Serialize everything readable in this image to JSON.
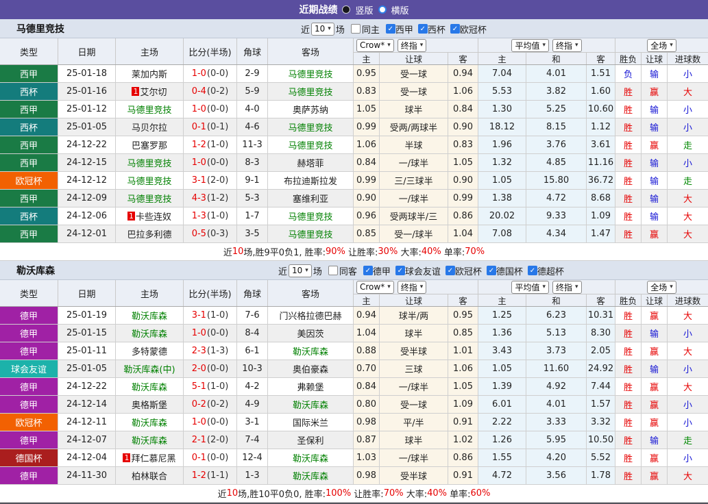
{
  "topbar": {
    "title": "近期战绩",
    "options": [
      {
        "label": "竖版",
        "selected": true
      },
      {
        "label": "横版",
        "selected": false
      }
    ]
  },
  "header": {
    "left_cols": [
      "类型",
      "日期",
      "主场",
      "比分(半场)",
      "角球",
      "客场"
    ],
    "group_selects": {
      "crow": "Crow*",
      "crow_final": "终指",
      "avg": "平均值",
      "avg_final": "终指",
      "scope": "全场"
    },
    "sub_cols_crow": [
      "主",
      "让球",
      "客"
    ],
    "sub_cols_avg": [
      "主",
      "和",
      "客"
    ],
    "sub_cols_result": [
      "胜负",
      "让球",
      "进球数"
    ]
  },
  "colors": {
    "league": {
      "西甲": "#1a7b45",
      "西杯": "#147c7c",
      "欧冠杯": "#f26102",
      "德甲": "#a021a5",
      "球会友谊": "#1cb2aa",
      "德国杯": "#aa1e1e"
    },
    "result": {
      "r": "#e60000",
      "b": "#1414d4",
      "g": "#008800"
    },
    "score_fulltime": "#e60000",
    "team_highlight": "#008000",
    "accent_bar": "#5a4e9f"
  },
  "sections": [
    {
      "team": "马德里竞技",
      "filter": {
        "prefix": "近",
        "count": "10",
        "suffix": "场",
        "same": {
          "label": "同主",
          "checked": false
        },
        "leagues": [
          {
            "label": "西甲",
            "checked": true
          },
          {
            "label": "西杯",
            "checked": true
          },
          {
            "label": "欧冠杯",
            "checked": true
          }
        ]
      },
      "rows": [
        {
          "league": "西甲",
          "date": "25-01-18",
          "home": "莱加内斯",
          "home_hl": false,
          "badge": null,
          "ft": "1-0",
          "ht": "(0-0)",
          "corner": "2-9",
          "away": "马德里竞技",
          "away_hl": true,
          "crow": [
            "0.95",
            "受一球",
            "0.94"
          ],
          "avg": [
            "7.04",
            "4.01",
            "1.51"
          ],
          "res": [
            [
              "负",
              "b"
            ],
            [
              "输",
              "b"
            ],
            [
              "小",
              "b"
            ]
          ]
        },
        {
          "league": "西杯",
          "date": "25-01-16",
          "home": "艾尔切",
          "home_hl": false,
          "badge": "1",
          "ft": "0-4",
          "ht": "(0-2)",
          "corner": "5-9",
          "away": "马德里竞技",
          "away_hl": true,
          "crow": [
            "0.83",
            "受一球",
            "1.06"
          ],
          "avg": [
            "5.53",
            "3.82",
            "1.60"
          ],
          "res": [
            [
              "胜",
              "r"
            ],
            [
              "赢",
              "r"
            ],
            [
              "大",
              "r"
            ]
          ]
        },
        {
          "league": "西甲",
          "date": "25-01-12",
          "home": "马德里竞技",
          "home_hl": true,
          "badge": null,
          "ft": "1-0",
          "ht": "(0-0)",
          "corner": "4-0",
          "away": "奥萨苏纳",
          "away_hl": false,
          "crow": [
            "1.05",
            "球半",
            "0.84"
          ],
          "avg": [
            "1.30",
            "5.25",
            "10.60"
          ],
          "res": [
            [
              "胜",
              "r"
            ],
            [
              "输",
              "b"
            ],
            [
              "小",
              "b"
            ]
          ]
        },
        {
          "league": "西杯",
          "date": "25-01-05",
          "home": "马贝尔拉",
          "home_hl": false,
          "badge": null,
          "ft": "0-1",
          "ht": "(0-1)",
          "corner": "4-6",
          "away": "马德里竞技",
          "away_hl": true,
          "crow": [
            "0.99",
            "受两/两球半",
            "0.90"
          ],
          "avg": [
            "18.12",
            "8.15",
            "1.12"
          ],
          "res": [
            [
              "胜",
              "r"
            ],
            [
              "输",
              "b"
            ],
            [
              "小",
              "b"
            ]
          ]
        },
        {
          "league": "西甲",
          "date": "24-12-22",
          "home": "巴塞罗那",
          "home_hl": false,
          "badge": null,
          "ft": "1-2",
          "ht": "(1-0)",
          "corner": "11-3",
          "away": "马德里竞技",
          "away_hl": true,
          "crow": [
            "1.06",
            "半球",
            "0.83"
          ],
          "avg": [
            "1.96",
            "3.76",
            "3.61"
          ],
          "res": [
            [
              "胜",
              "r"
            ],
            [
              "赢",
              "r"
            ],
            [
              "走",
              "g"
            ]
          ]
        },
        {
          "league": "西甲",
          "date": "24-12-15",
          "home": "马德里竞技",
          "home_hl": true,
          "badge": null,
          "ft": "1-0",
          "ht": "(0-0)",
          "corner": "8-3",
          "away": "赫塔菲",
          "away_hl": false,
          "crow": [
            "0.84",
            "一/球半",
            "1.05"
          ],
          "avg": [
            "1.32",
            "4.85",
            "11.16"
          ],
          "res": [
            [
              "胜",
              "r"
            ],
            [
              "输",
              "b"
            ],
            [
              "小",
              "b"
            ]
          ]
        },
        {
          "league": "欧冠杯",
          "date": "24-12-12",
          "home": "马德里竞技",
          "home_hl": true,
          "badge": null,
          "ft": "3-1",
          "ht": "(2-0)",
          "corner": "9-1",
          "away": "布拉迪斯拉发",
          "away_hl": false,
          "crow": [
            "0.99",
            "三/三球半",
            "0.90"
          ],
          "avg": [
            "1.05",
            "15.80",
            "36.72"
          ],
          "res": [
            [
              "胜",
              "r"
            ],
            [
              "输",
              "b"
            ],
            [
              "走",
              "g"
            ]
          ]
        },
        {
          "league": "西甲",
          "date": "24-12-09",
          "home": "马德里竞技",
          "home_hl": true,
          "badge": null,
          "ft": "4-3",
          "ht": "(1-2)",
          "corner": "5-3",
          "away": "塞维利亚",
          "away_hl": false,
          "crow": [
            "0.90",
            "一/球半",
            "0.99"
          ],
          "avg": [
            "1.38",
            "4.72",
            "8.68"
          ],
          "res": [
            [
              "胜",
              "r"
            ],
            [
              "输",
              "b"
            ],
            [
              "大",
              "r"
            ]
          ]
        },
        {
          "league": "西杯",
          "date": "24-12-06",
          "home": "卡些连奴",
          "home_hl": false,
          "badge": "1",
          "ft": "1-3",
          "ht": "(1-0)",
          "corner": "1-7",
          "away": "马德里竞技",
          "away_hl": true,
          "crow": [
            "0.96",
            "受两球半/三",
            "0.86"
          ],
          "avg": [
            "20.02",
            "9.33",
            "1.09"
          ],
          "res": [
            [
              "胜",
              "r"
            ],
            [
              "输",
              "b"
            ],
            [
              "大",
              "r"
            ]
          ]
        },
        {
          "league": "西甲",
          "date": "24-12-01",
          "home": "巴拉多利德",
          "home_hl": false,
          "badge": null,
          "ft": "0-5",
          "ht": "(0-3)",
          "corner": "3-5",
          "away": "马德里竞技",
          "away_hl": true,
          "crow": [
            "0.85",
            "受一/球半",
            "1.04"
          ],
          "avg": [
            "7.08",
            "4.34",
            "1.47"
          ],
          "res": [
            [
              "胜",
              "r"
            ],
            [
              "赢",
              "r"
            ],
            [
              "大",
              "r"
            ]
          ]
        }
      ],
      "summary": [
        [
          "近",
          0
        ],
        [
          "10",
          1
        ],
        [
          "场,胜9平0负1, 胜率:",
          0
        ],
        [
          "90%",
          1
        ],
        [
          " 让胜率:",
          0
        ],
        [
          "30%",
          1
        ],
        [
          " 大率:",
          0
        ],
        [
          "40%",
          1
        ],
        [
          " 单率:",
          0
        ],
        [
          "70%",
          1
        ]
      ]
    },
    {
      "team": "勒沃库森",
      "filter": {
        "prefix": "近",
        "count": "10",
        "suffix": "场",
        "same": {
          "label": "同客",
          "checked": false
        },
        "leagues": [
          {
            "label": "德甲",
            "checked": true
          },
          {
            "label": "球会友谊",
            "checked": true
          },
          {
            "label": "欧冠杯",
            "checked": true
          },
          {
            "label": "德国杯",
            "checked": true
          },
          {
            "label": "德超杯",
            "checked": true
          }
        ]
      },
      "rows": [
        {
          "league": "德甲",
          "date": "25-01-19",
          "home": "勒沃库森",
          "home_hl": true,
          "badge": null,
          "ft": "3-1",
          "ht": "(1-0)",
          "corner": "7-6",
          "away": "门兴格拉德巴赫",
          "away_hl": false,
          "crow": [
            "0.94",
            "球半/两",
            "0.95"
          ],
          "avg": [
            "1.25",
            "6.23",
            "10.31"
          ],
          "res": [
            [
              "胜",
              "r"
            ],
            [
              "赢",
              "r"
            ],
            [
              "大",
              "r"
            ]
          ]
        },
        {
          "league": "德甲",
          "date": "25-01-15",
          "home": "勒沃库森",
          "home_hl": true,
          "badge": null,
          "ft": "1-0",
          "ht": "(0-0)",
          "corner": "8-4",
          "away": "美因茨",
          "away_hl": false,
          "crow": [
            "1.04",
            "球半",
            "0.85"
          ],
          "avg": [
            "1.36",
            "5.13",
            "8.30"
          ],
          "res": [
            [
              "胜",
              "r"
            ],
            [
              "输",
              "b"
            ],
            [
              "小",
              "b"
            ]
          ]
        },
        {
          "league": "德甲",
          "date": "25-01-11",
          "home": "多特蒙德",
          "home_hl": false,
          "badge": null,
          "ft": "2-3",
          "ht": "(1-3)",
          "corner": "6-1",
          "away": "勒沃库森",
          "away_hl": true,
          "crow": [
            "0.88",
            "受半球",
            "1.01"
          ],
          "avg": [
            "3.43",
            "3.73",
            "2.05"
          ],
          "res": [
            [
              "胜",
              "r"
            ],
            [
              "赢",
              "r"
            ],
            [
              "大",
              "r"
            ]
          ]
        },
        {
          "league": "球会友谊",
          "date": "25-01-05",
          "home": "勒沃库森(中)",
          "home_hl": true,
          "badge": null,
          "ft": "2-0",
          "ht": "(0-0)",
          "corner": "10-3",
          "away": "奥伯豪森",
          "away_hl": false,
          "crow": [
            "0.70",
            "三球",
            "1.06"
          ],
          "avg": [
            "1.05",
            "11.60",
            "24.92"
          ],
          "res": [
            [
              "胜",
              "r"
            ],
            [
              "输",
              "b"
            ],
            [
              "小",
              "b"
            ]
          ]
        },
        {
          "league": "德甲",
          "date": "24-12-22",
          "home": "勒沃库森",
          "home_hl": true,
          "badge": null,
          "ft": "5-1",
          "ht": "(1-0)",
          "corner": "4-2",
          "away": "弗赖堡",
          "away_hl": false,
          "crow": [
            "0.84",
            "一/球半",
            "1.05"
          ],
          "avg": [
            "1.39",
            "4.92",
            "7.44"
          ],
          "res": [
            [
              "胜",
              "r"
            ],
            [
              "赢",
              "r"
            ],
            [
              "大",
              "r"
            ]
          ]
        },
        {
          "league": "德甲",
          "date": "24-12-14",
          "home": "奥格斯堡",
          "home_hl": false,
          "badge": null,
          "ft": "0-2",
          "ht": "(0-2)",
          "corner": "4-9",
          "away": "勒沃库森",
          "away_hl": true,
          "crow": [
            "0.80",
            "受一球",
            "1.09"
          ],
          "avg": [
            "6.01",
            "4.01",
            "1.57"
          ],
          "res": [
            [
              "胜",
              "r"
            ],
            [
              "赢",
              "r"
            ],
            [
              "小",
              "b"
            ]
          ]
        },
        {
          "league": "欧冠杯",
          "date": "24-12-11",
          "home": "勒沃库森",
          "home_hl": true,
          "badge": null,
          "ft": "1-0",
          "ht": "(0-0)",
          "corner": "3-1",
          "away": "国际米兰",
          "away_hl": false,
          "crow": [
            "0.98",
            "平/半",
            "0.91"
          ],
          "avg": [
            "2.22",
            "3.33",
            "3.32"
          ],
          "res": [
            [
              "胜",
              "r"
            ],
            [
              "赢",
              "r"
            ],
            [
              "小",
              "b"
            ]
          ]
        },
        {
          "league": "德甲",
          "date": "24-12-07",
          "home": "勒沃库森",
          "home_hl": true,
          "badge": null,
          "ft": "2-1",
          "ht": "(2-0)",
          "corner": "7-4",
          "away": "圣保利",
          "away_hl": false,
          "crow": [
            "0.87",
            "球半",
            "1.02"
          ],
          "avg": [
            "1.26",
            "5.95",
            "10.50"
          ],
          "res": [
            [
              "胜",
              "r"
            ],
            [
              "输",
              "b"
            ],
            [
              "走",
              "g"
            ]
          ]
        },
        {
          "league": "德国杯",
          "date": "24-12-04",
          "home": "拜仁慕尼黑",
          "home_hl": false,
          "badge": "1",
          "ft": "0-1",
          "ht": "(0-0)",
          "corner": "12-4",
          "away": "勒沃库森",
          "away_hl": true,
          "crow": [
            "1.03",
            "一/球半",
            "0.86"
          ],
          "avg": [
            "1.55",
            "4.20",
            "5.52"
          ],
          "res": [
            [
              "胜",
              "r"
            ],
            [
              "赢",
              "r"
            ],
            [
              "小",
              "b"
            ]
          ]
        },
        {
          "league": "德甲",
          "date": "24-11-30",
          "home": "柏林联合",
          "home_hl": false,
          "badge": null,
          "ft": "1-2",
          "ht": "(1-1)",
          "corner": "1-3",
          "away": "勒沃库森",
          "away_hl": true,
          "crow": [
            "0.98",
            "受半球",
            "0.91"
          ],
          "avg": [
            "4.72",
            "3.56",
            "1.78"
          ],
          "res": [
            [
              "胜",
              "r"
            ],
            [
              "赢",
              "r"
            ],
            [
              "大",
              "r"
            ]
          ]
        }
      ],
      "summary": [
        [
          "近",
          0
        ],
        [
          "10",
          1
        ],
        [
          "场,胜10平0负0, 胜率:",
          0
        ],
        [
          "100%",
          1
        ],
        [
          " 让胜率:",
          0
        ],
        [
          "70%",
          1
        ],
        [
          " 大率:",
          0
        ],
        [
          "40%",
          1
        ],
        [
          " 单率:",
          0
        ],
        [
          "60%",
          1
        ]
      ]
    }
  ]
}
